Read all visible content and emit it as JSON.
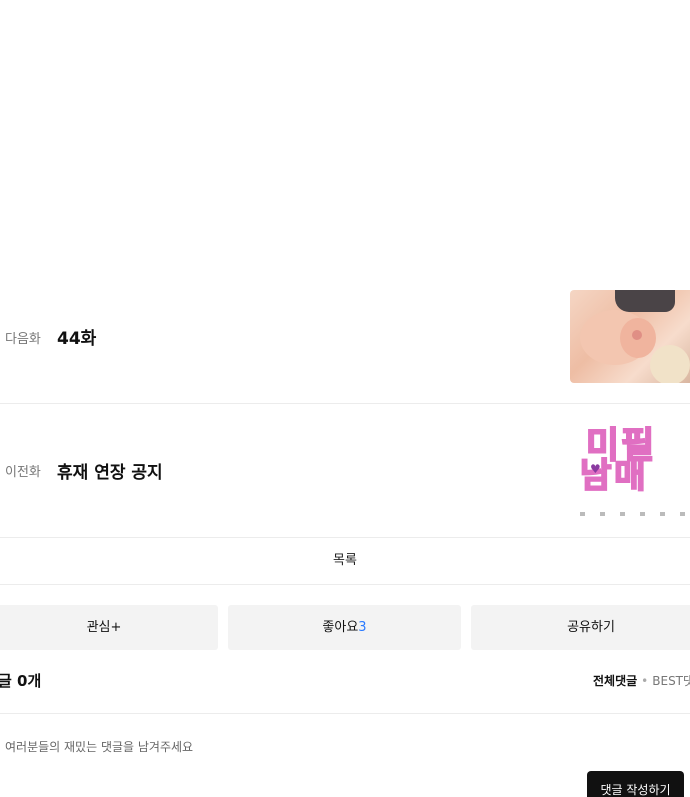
{
  "next_episode": {
    "tag": "다음화",
    "title": "44화"
  },
  "prev_episode": {
    "tag": "이전화",
    "title": "휴재 연장 공지",
    "thumbnail_logo": [
      "미필",
      "남매"
    ]
  },
  "list_button": {
    "label": "목록"
  },
  "actions": {
    "interest_label": "관심+",
    "like_label": "좋아요",
    "like_count": "3",
    "share_label": "공유하기"
  },
  "comments": {
    "count_label": "글 0개",
    "sort_all": "전체댓글",
    "sort_separator": "•",
    "sort_best": "BEST댓",
    "placeholder": "여러분들의 재밌는 댓글을 남겨주세요",
    "write_button": "댓글 작성하기"
  },
  "colors": {
    "accent": "#2b7bff",
    "button_bg": "#f3f3f3",
    "write_button_bg": "#111111"
  }
}
